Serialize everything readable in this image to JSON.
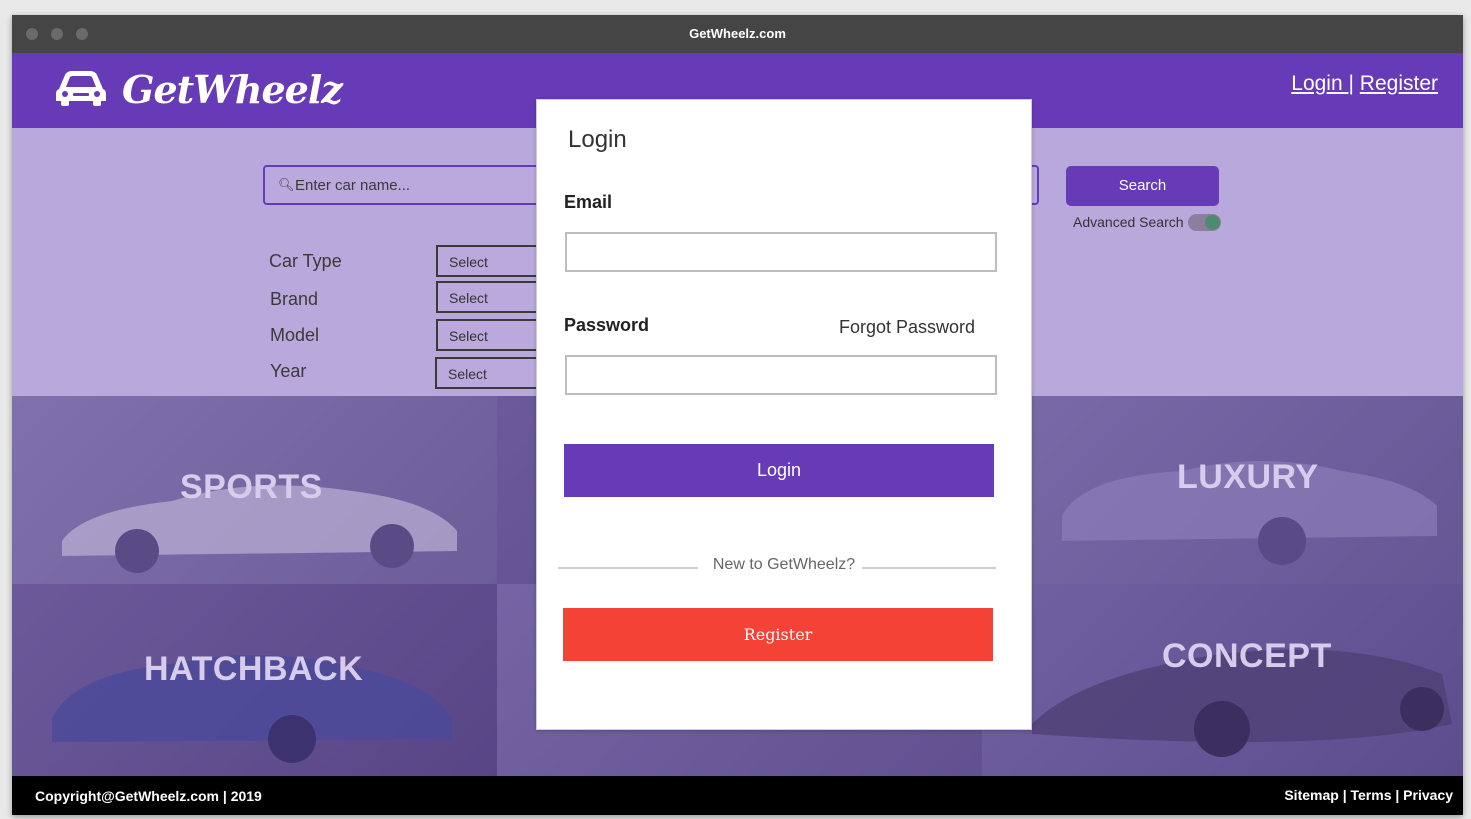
{
  "window": {
    "title": "GetWheelz.com"
  },
  "header": {
    "logo_text": "GetWheelz",
    "login_link": "Login ",
    "separator": "|",
    "register_link": "Register"
  },
  "search": {
    "placeholder": "Enter car name...",
    "search_button": "Search",
    "advanced_label": "Advanced Search",
    "advanced_enabled": true
  },
  "filters": [
    {
      "label": "Car Type",
      "value": "Select"
    },
    {
      "label": "Brand",
      "value": "Select"
    },
    {
      "label": "Model",
      "value": "Select"
    },
    {
      "label": "Year",
      "value": "Select"
    }
  ],
  "categories": [
    {
      "label": "SPORTS"
    },
    {
      "label": "LUXURY"
    },
    {
      "label": "HATCHBACK"
    },
    {
      "label": "CONCEPT"
    }
  ],
  "footer": {
    "copyright": "Copyright@GetWheelz.com | 2019",
    "links": "Sitemap | Terms | Privacy"
  },
  "login_modal": {
    "title": "Login",
    "email_label": "Email",
    "email_value": "",
    "password_label": "Password",
    "password_value": "",
    "forgot_password": "Forgot Password",
    "login_button": "Login",
    "new_user_text": "New to GetWheelz?",
    "register_button": "Register"
  },
  "colors": {
    "brand": "#673ab7",
    "search_bg": "#b9a8dc",
    "register": "#f44336",
    "footer": "#000000"
  }
}
